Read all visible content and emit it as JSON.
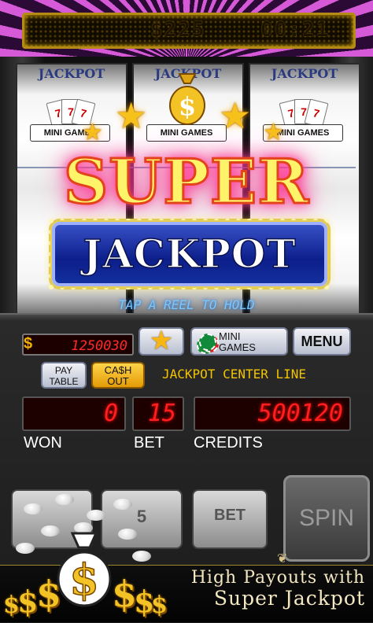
{
  "status_bar": {
    "balance": "$225",
    "timer": "00:21"
  },
  "reels": {
    "top_label": "JACKPOT",
    "mini_games_label": "MINI GAMES"
  },
  "banner": {
    "super": "SUPER",
    "jackpot": "JACKPOT"
  },
  "hint": "TAP A REEL TO HOLD",
  "controls": {
    "jackpot_symbol": "$",
    "jackpot_value": "1250030",
    "mini_games_label": "MINI\nGAMES",
    "menu_label": "MENU",
    "pay_table_label": "PAY\nTABLE",
    "cash_out_label": "CA$H\nOUT",
    "center_line_text": "JACKPOT CENTER LINE",
    "won_value": "0",
    "bet_value": "15",
    "credits_value": "500120",
    "won_label": "WON",
    "bet_label": "BET",
    "credits_label": "CREDITS",
    "bet_lines_label": "5",
    "bet_max_label": "BET",
    "spin_label": "SPIN"
  },
  "promo": {
    "line1": "High Payouts with",
    "line2": "Super Jackpot"
  },
  "colors": {
    "accent_gold": "#f2c400",
    "led_red": "#ff1e1e",
    "banner_blue": "#0c1e8a"
  }
}
